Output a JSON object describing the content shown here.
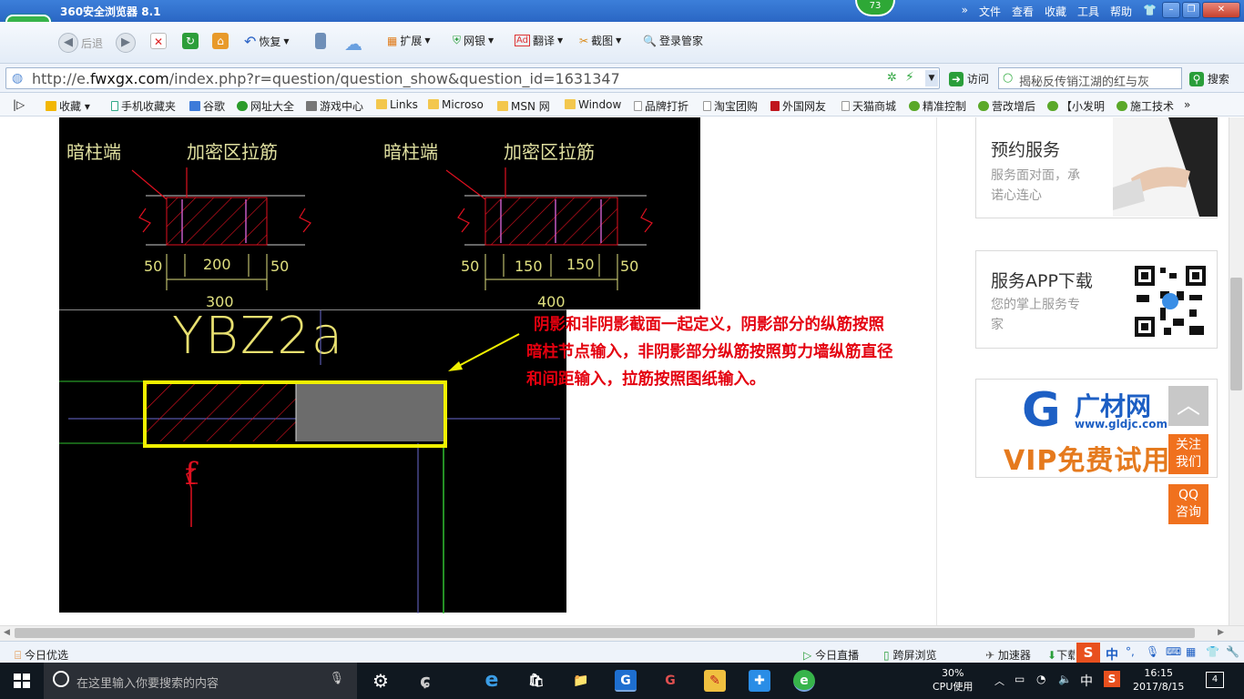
{
  "window": {
    "title": "360安全浏览器 8.1",
    "badge": "73",
    "menu": [
      "文件",
      "查看",
      "收藏",
      "工具",
      "帮助"
    ]
  },
  "toolbar": {
    "back": "后退",
    "restore": "恢复",
    "extend": "扩展",
    "bank": "网银",
    "translate": "翻译",
    "screenshot": "截图",
    "login": "登录管家"
  },
  "address": {
    "url_prefix": "http://e.",
    "url_domain": "fwxgx.com",
    "url_path": "/index.php?r=question/question_show&question_id=1631347",
    "go": "访问",
    "search_placeholder": "揭秘反传销江湖的红与灰",
    "search": "搜索"
  },
  "favorites": [
    "收藏",
    "手机收藏夹",
    "谷歌",
    "网址大全",
    "游戏中心",
    "Links",
    "Microso",
    "MSN 网",
    "Window",
    "品牌打折",
    "淘宝团购",
    "外国网友",
    "天猫商城",
    "精准控制",
    "营改增后",
    "【小发明",
    "施工技术"
  ],
  "drawing": {
    "label_a": "暗柱端",
    "label_b": "加密区拉筋",
    "dims_left": [
      "50",
      "200",
      "50",
      "300"
    ],
    "dims_right": [
      "50",
      "150",
      "150",
      "50",
      "400"
    ],
    "element_name": "YBZ2a",
    "marker": "f"
  },
  "annotation": {
    "line1": "阴影和非阴影截面一起定义，阴影部分的纵筋按照",
    "line2": "暗柱节点输入，非阴影部分纵筋按照剪力墙纵筋直径",
    "line3": "和间距输入，拉筋按照图纸输入。"
  },
  "sidebar": {
    "booking_title": "预约服务",
    "booking_sub1": "服务面对面，承",
    "booking_sub2": "诺心连心",
    "app_title": "服务APP下载",
    "app_sub1": "您的掌上服务专",
    "app_sub2": "家",
    "ad_brand": "广材网",
    "ad_url": "www.gldjc.com",
    "ad_vip": "VIP免费试用",
    "follow": "关注我们",
    "qq": "QQ咨询"
  },
  "statusbar": {
    "left": "今日优选",
    "live": "今日直播",
    "crossscreen": "跨屏浏览",
    "accelerator": "加速器",
    "download": "下载"
  },
  "taskbar": {
    "search_placeholder": "在这里输入你要搜索的内容",
    "cpu_pct": "30%",
    "cpu_label": "CPU使用",
    "ime": "中",
    "time": "16:15",
    "date": "2017/8/15",
    "notifications": "4"
  }
}
